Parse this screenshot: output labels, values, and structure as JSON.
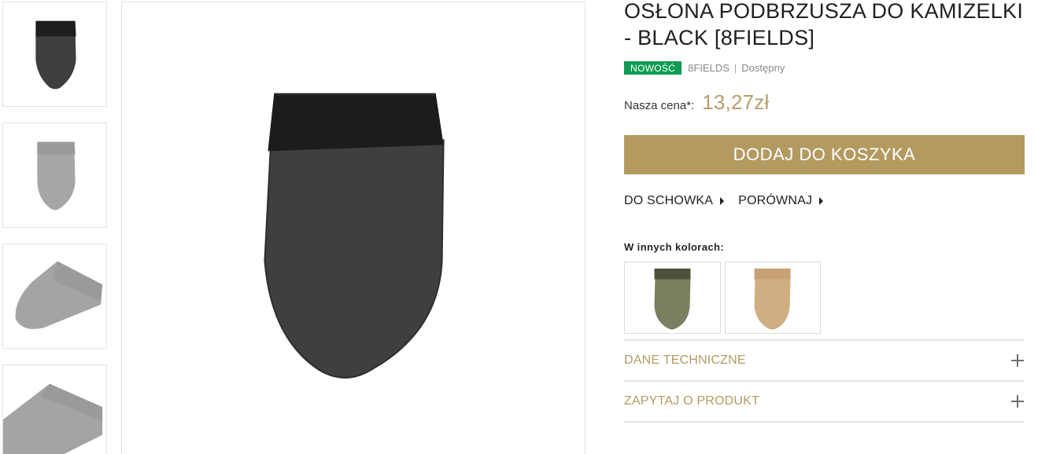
{
  "product": {
    "title": "OSŁONA PODBRZUSZA DO KAMIZELKI - BLACK [8FIELDS]",
    "badge": "NOWOŚĆ",
    "brand": "8FIELDS",
    "separator": "|",
    "availability": "Dostępny",
    "price_label": "Nasza cena*:",
    "price": "13,27zł"
  },
  "actions": {
    "add_to_cart": "DODAJ DO KOSZYKA",
    "wishlist": "DO SCHOWKA",
    "compare": "PORÓWNAJ"
  },
  "colors": {
    "label": "W innych kolorach:",
    "options": [
      {
        "name": "olive-variant",
        "color": "#7b7e5f",
        "band": "#4c5338"
      },
      {
        "name": "coyote-variant",
        "color": "#d1ad82",
        "band": "#c7a173"
      }
    ]
  },
  "accordion": {
    "technical": "DANE TECHNICZNE",
    "ask": "ZAPYTAJ O PRODUKT"
  },
  "gallery": {
    "main_color": "#3f3f3f",
    "band_color": "#1c1c1c",
    "thumbs": [
      "front-black",
      "front-grey",
      "side-angle",
      "side-angle-close"
    ]
  },
  "theme": {
    "accent": "#b39a61",
    "badge": "#0f9b55"
  }
}
